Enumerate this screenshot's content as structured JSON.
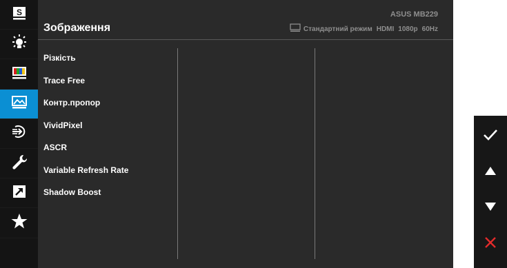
{
  "header": {
    "title": "Зображення",
    "model": "ASUS MB229",
    "status_mode": "Стандартний режим",
    "status_input": "HDMI",
    "status_resolution": "1080p",
    "status_refresh": "60Hz"
  },
  "menu": {
    "items": [
      {
        "label": "Різкість"
      },
      {
        "label": "Trace Free"
      },
      {
        "label": "Контр.пропор"
      },
      {
        "label": "VividPixel"
      },
      {
        "label": "ASCR"
      },
      {
        "label": "Variable Refresh Rate"
      },
      {
        "label": "Shadow Boost"
      }
    ]
  },
  "sidebar": {
    "items": [
      {
        "icon": "splendid-icon",
        "active": false
      },
      {
        "icon": "brightness-icon",
        "active": false
      },
      {
        "icon": "color-icon",
        "active": false
      },
      {
        "icon": "image-icon",
        "active": true
      },
      {
        "icon": "input-select-icon",
        "active": false
      },
      {
        "icon": "system-setup-icon",
        "active": false
      },
      {
        "icon": "shortcut-icon",
        "active": false
      },
      {
        "icon": "my-favorite-icon",
        "active": false
      }
    ]
  },
  "controls": {
    "icons": [
      "check-icon",
      "arrow-up-icon",
      "arrow-down-icon",
      "close-icon"
    ]
  },
  "colors": {
    "accent": "#0b8fd3",
    "close": "#e32b2b",
    "panel": "#2a2a2a",
    "sidebar": "#141414"
  }
}
